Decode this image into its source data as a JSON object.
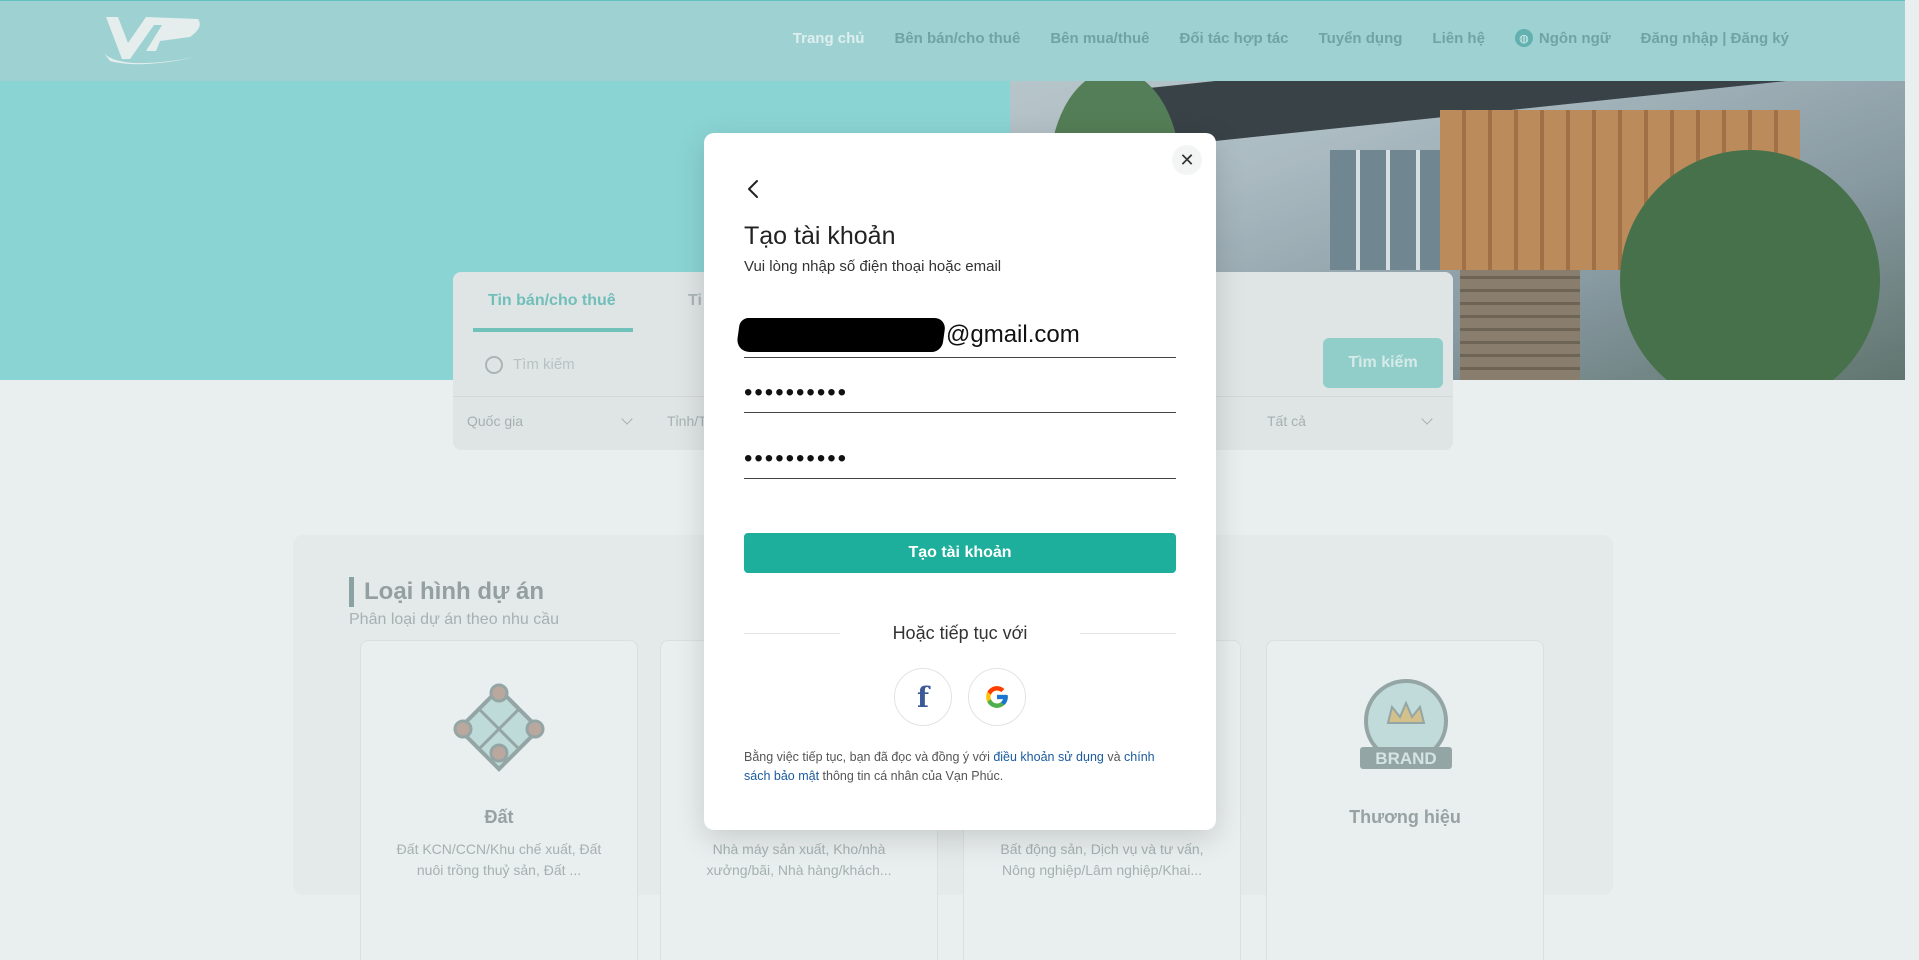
{
  "nav": {
    "items": [
      {
        "label": "Trang chủ",
        "active": true
      },
      {
        "label": "Bên bán/cho thuê"
      },
      {
        "label": "Bên mua/thuê"
      },
      {
        "label": "Đối tác hợp tác"
      },
      {
        "label": "Tuyển dụng"
      },
      {
        "label": "Liên hệ"
      }
    ],
    "language_label": "Ngôn ngữ",
    "auth_label": "Đăng nhập | Đăng ký"
  },
  "search": {
    "tab_active": "Tin bán/cho thuê",
    "tab_other": "Ti",
    "placeholder": "Tìm kiếm",
    "button": "Tìm kiếm",
    "filters": {
      "country": "Quốc gia",
      "province": "Tỉnh/T",
      "all": "Tất cả"
    }
  },
  "projects": {
    "title": "Loại hình dự án",
    "subtitle": "Phân loại dự án theo nhu cầu",
    "cards": [
      {
        "name": "Đất",
        "desc": "Đất KCN/CCN/Khu chế xuất, Đất nuôi trồng thuỷ sản, Đất ..."
      },
      {
        "name": "",
        "desc": "Nhà máy sản xuất, Kho/nhà xưởng/bãi, Nhà hàng/khách..."
      },
      {
        "name": "",
        "desc": "Bất động sản, Dịch vụ và tư vấn, Nông nghiệp/Lâm nghiệp/Khai..."
      },
      {
        "name": "Thương hiệu",
        "desc": "",
        "badge": "BRAND"
      }
    ]
  },
  "modal": {
    "title": "Tạo tài khoản",
    "subtitle": "Vui lòng nhập số điện thoại hoặc email",
    "email_suffix": "@gmail.com",
    "password_mask": "••••••••••",
    "confirm_mask": "••••••••••",
    "submit": "Tạo tài khoản",
    "or_text": "Hoặc tiếp tục với",
    "terms": {
      "prefix": "Bằng việc tiếp tục, bạn đã đọc và đồng ý với ",
      "link1": "điều khoản sử dụng",
      "mid": " và ",
      "link2": "chính sách bảo mật",
      "suffix": " thông tin cá nhân của Vạn Phúc."
    }
  },
  "colors": {
    "brand": "#1daf9c",
    "hero": "#8fe0e0",
    "link": "#1a5a9e"
  }
}
